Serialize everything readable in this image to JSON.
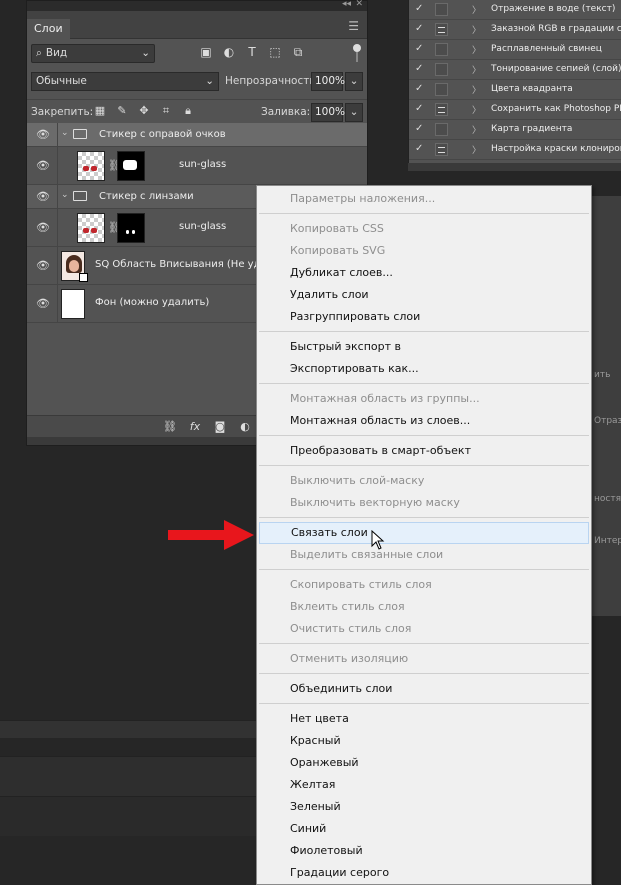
{
  "layers_panel": {
    "tab_label": "Слои",
    "filter_label": "Вид",
    "blend_mode": "Обычные",
    "opacity_label": "Непрозрачность:",
    "opacity_value": "100%",
    "lock_label": "Закрепить:",
    "fill_label": "Заливка:",
    "fill_value": "100%",
    "layers": [
      {
        "name": "Стикер с оправой очков"
      },
      {
        "name": "sun-glass"
      },
      {
        "name": "Стикер с линзами"
      },
      {
        "name": "sun-glass"
      },
      {
        "name": "SQ Область Вписывания (Не удаля"
      },
      {
        "name": "Фон (можно удалить)"
      }
    ]
  },
  "actions_panel": {
    "items": [
      {
        "label": "Отражение в воде (текст)"
      },
      {
        "label": "Заказной RGB в градации серого"
      },
      {
        "label": "Расплавленный свинец"
      },
      {
        "label": "Тонирование сепией (слой)"
      },
      {
        "label": "Цвета квадранта"
      },
      {
        "label": "Сохранить как Photoshop PDF"
      },
      {
        "label": "Карта градиента"
      },
      {
        "label": "Настройка краски клонирова"
      }
    ]
  },
  "right_fragments": [
    "ить",
    "Отраз",
    "ностя",
    "Интер"
  ],
  "context_menu": {
    "items": [
      {
        "label": "Параметры наложения..."
      },
      {
        "label": "Копировать CSS"
      },
      {
        "label": "Копировать SVG"
      },
      {
        "label": "Дубликат слоев..."
      },
      {
        "label": "Удалить слои"
      },
      {
        "label": "Разгруппировать слои"
      },
      {
        "label": "Быстрый экспорт в"
      },
      {
        "label": "Экспортировать как..."
      },
      {
        "label": "Монтажная область из группы..."
      },
      {
        "label": "Монтажная область из слоев..."
      },
      {
        "label": "Преобразовать в смарт-объект"
      },
      {
        "label": "Выключить слой-маску"
      },
      {
        "label": "Выключить векторную маску"
      },
      {
        "label": "Связать слои"
      },
      {
        "label": "Выделить связанные слои"
      },
      {
        "label": "Скопировать стиль слоя"
      },
      {
        "label": "Вклеить стиль слоя"
      },
      {
        "label": "Очистить стиль слоя"
      },
      {
        "label": "Отменить изоляцию"
      },
      {
        "label": "Объединить слои"
      },
      {
        "label": "Нет цвета"
      },
      {
        "label": "Красный"
      },
      {
        "label": "Оранжевый"
      },
      {
        "label": "Желтая"
      },
      {
        "label": "Зеленый"
      },
      {
        "label": "Синий"
      },
      {
        "label": "Фиолетовый"
      },
      {
        "label": "Градации серого"
      }
    ]
  },
  "colors": {
    "annotation_arrow": "#e8161c",
    "menu_hover": "#e5f0fb"
  }
}
